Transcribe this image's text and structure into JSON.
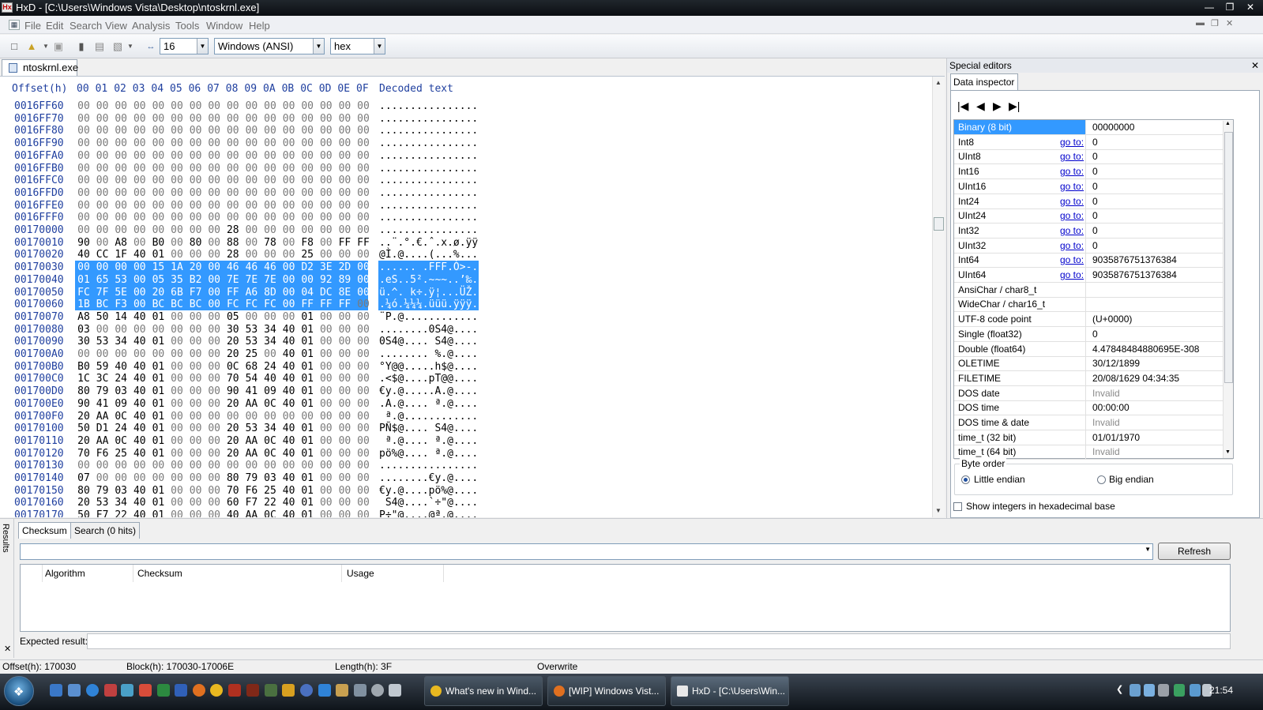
{
  "window": {
    "title": "HxD - [C:\\Users\\Windows Vista\\Desktop\\ntoskrnl.exe]"
  },
  "menu": [
    "File",
    "Edit",
    "Search",
    "View",
    "Analysis",
    "Tools",
    "Window",
    "Help"
  ],
  "toolbar": {
    "bytes_per_row": "16",
    "charset": "Windows (ANSI)",
    "offset_base": "hex"
  },
  "file_tab": "ntoskrnl.exe",
  "hex": {
    "offset_header": "Offset(h)",
    "columns": [
      "00",
      "01",
      "02",
      "03",
      "04",
      "05",
      "06",
      "07",
      "08",
      "09",
      "0A",
      "0B",
      "0C",
      "0D",
      "0E",
      "0F"
    ],
    "decoded_header": "Decoded text",
    "rows": [
      {
        "o": "0016FF60",
        "b": "00 00 00 00 00 00 00 00 00 00 00 00 00 00 00 00",
        "t": "................"
      },
      {
        "o": "0016FF70",
        "b": "00 00 00 00 00 00 00 00 00 00 00 00 00 00 00 00",
        "t": "................"
      },
      {
        "o": "0016FF80",
        "b": "00 00 00 00 00 00 00 00 00 00 00 00 00 00 00 00",
        "t": "................"
      },
      {
        "o": "0016FF90",
        "b": "00 00 00 00 00 00 00 00 00 00 00 00 00 00 00 00",
        "t": "................"
      },
      {
        "o": "0016FFA0",
        "b": "00 00 00 00 00 00 00 00 00 00 00 00 00 00 00 00",
        "t": "................"
      },
      {
        "o": "0016FFB0",
        "b": "00 00 00 00 00 00 00 00 00 00 00 00 00 00 00 00",
        "t": "................"
      },
      {
        "o": "0016FFC0",
        "b": "00 00 00 00 00 00 00 00 00 00 00 00 00 00 00 00",
        "t": "................"
      },
      {
        "o": "0016FFD0",
        "b": "00 00 00 00 00 00 00 00 00 00 00 00 00 00 00 00",
        "t": "................"
      },
      {
        "o": "0016FFE0",
        "b": "00 00 00 00 00 00 00 00 00 00 00 00 00 00 00 00",
        "t": "................"
      },
      {
        "o": "0016FFF0",
        "b": "00 00 00 00 00 00 00 00 00 00 00 00 00 00 00 00",
        "t": "................"
      },
      {
        "o": "00170000",
        "b": "00 00 00 00 00 00 00 00 28 00 00 00 00 00 00 00",
        "t": "................"
      },
      {
        "o": "00170010",
        "b": "90 00 A8 00 B0 00 80 00 88 00 78 00 F8 00 FF FF",
        "t": "..¨.°.€.ˆ.x.ø.ÿÿ"
      },
      {
        "o": "00170020",
        "b": "40 CC 1F 40 01 00 00 00 28 00 00 00 25 00 00 00",
        "t": "@Ì.@....(...%..."
      },
      {
        "o": "00170030",
        "b": "00 00 00 00 15 1A 20 00 46 46 46 00 D2 3E 2D 00",
        "t": "...... .FFF.Ò>-."
      },
      {
        "o": "00170040",
        "b": "01 65 53 00 05 35 B2 00 7E 7E 7E 00 00 92 89 00",
        "t": ".eS..5².~~~..’‰."
      },
      {
        "o": "00170050",
        "b": "FC 7F 5E 00 20 6B F7 00 FF A6 8D 00 04 DC 8E 00",
        "t": "ü.^. k÷.ÿ¦...ÜŽ."
      },
      {
        "o": "00170060",
        "b": "1B BC F3 00 BC BC BC 00 FC FC FC 00 FF FF FF 00",
        "t": ".¼ó.¼¼¼.üüü.ÿÿÿ."
      },
      {
        "o": "00170070",
        "b": "A8 50 14 40 01 00 00 00 05 00 00 00 01 00 00 00",
        "t": "¨P.@............"
      },
      {
        "o": "00170080",
        "b": "03 00 00 00 00 00 00 00 30 53 34 40 01 00 00 00",
        "t": "........0S4@...."
      },
      {
        "o": "00170090",
        "b": "30 53 34 40 01 00 00 00 20 53 34 40 01 00 00 00",
        "t": "0S4@.... S4@...."
      },
      {
        "o": "001700A0",
        "b": "00 00 00 00 00 00 00 00 20 25 00 40 01 00 00 00",
        "t": "........ %.@...."
      },
      {
        "o": "001700B0",
        "b": "B0 59 40 40 01 00 00 00 0C 68 24 40 01 00 00 00",
        "t": "°Y@@.....h$@...."
      },
      {
        "o": "001700C0",
        "b": "1C 3C 24 40 01 00 00 00 70 54 40 40 01 00 00 00",
        "t": ".<$@....pT@@...."
      },
      {
        "o": "001700D0",
        "b": "80 79 03 40 01 00 00 00 90 41 09 40 01 00 00 00",
        "t": "€y.@.....A.@...."
      },
      {
        "o": "001700E0",
        "b": "90 41 09 40 01 00 00 00 20 AA 0C 40 01 00 00 00",
        "t": ".A.@.... ª.@...."
      },
      {
        "o": "001700F0",
        "b": "20 AA 0C 40 01 00 00 00 00 00 00 00 00 00 00 00",
        "t": " ª.@............"
      },
      {
        "o": "00170100",
        "b": "50 D1 24 40 01 00 00 00 20 53 34 40 01 00 00 00",
        "t": "PÑ$@.... S4@...."
      },
      {
        "o": "00170110",
        "b": "20 AA 0C 40 01 00 00 00 20 AA 0C 40 01 00 00 00",
        "t": " ª.@.... ª.@...."
      },
      {
        "o": "00170120",
        "b": "70 F6 25 40 01 00 00 00 20 AA 0C 40 01 00 00 00",
        "t": "pö%@.... ª.@...."
      },
      {
        "o": "00170130",
        "b": "00 00 00 00 00 00 00 00 00 00 00 00 00 00 00 00",
        "t": "................"
      },
      {
        "o": "00170140",
        "b": "07 00 00 00 00 00 00 00 80 79 03 40 01 00 00 00",
        "t": "........€y.@...."
      },
      {
        "o": "00170150",
        "b": "80 79 03 40 01 00 00 00 70 F6 25 40 01 00 00 00",
        "t": "€y.@....pö%@...."
      },
      {
        "o": "00170160",
        "b": "20 53 34 40 01 00 00 00 60 F7 22 40 01 00 00 00",
        "t": " S4@....`÷\"@...."
      },
      {
        "o": "00170170",
        "b": "50 F7 22 40 01 00 00 00 40 AA 0C 40 01 00 00 00",
        "t": "P÷\"@....@ª.@...."
      }
    ]
  },
  "special_editors": {
    "title": "Special editors",
    "tab": "Data inspector",
    "rows": [
      {
        "name": "Binary (8 bit)",
        "goto": "",
        "value": "00000000"
      },
      {
        "name": "Int8",
        "goto": "go to:",
        "value": "0"
      },
      {
        "name": "UInt8",
        "goto": "go to:",
        "value": "0"
      },
      {
        "name": "Int16",
        "goto": "go to:",
        "value": "0"
      },
      {
        "name": "UInt16",
        "goto": "go to:",
        "value": "0"
      },
      {
        "name": "Int24",
        "goto": "go to:",
        "value": "0"
      },
      {
        "name": "UInt24",
        "goto": "go to:",
        "value": "0"
      },
      {
        "name": "Int32",
        "goto": "go to:",
        "value": "0"
      },
      {
        "name": "UInt32",
        "goto": "go to:",
        "value": "0"
      },
      {
        "name": "Int64",
        "goto": "go to:",
        "value": "9035876751376384"
      },
      {
        "name": "UInt64",
        "goto": "go to:",
        "value": "9035876751376384"
      },
      {
        "name": "AnsiChar / char8_t",
        "goto": "",
        "value": ""
      },
      {
        "name": "WideChar / char16_t",
        "goto": "",
        "value": ""
      },
      {
        "name": "UTF-8 code point",
        "goto": "",
        "value": "  (U+0000)"
      },
      {
        "name": "Single (float32)",
        "goto": "",
        "value": "0"
      },
      {
        "name": "Double (float64)",
        "goto": "",
        "value": "4.47848484880695E-308"
      },
      {
        "name": "OLETIME",
        "goto": "",
        "value": "30/12/1899"
      },
      {
        "name": "FILETIME",
        "goto": "",
        "value": "20/08/1629 04:34:35"
      },
      {
        "name": "DOS date",
        "goto": "",
        "value": "Invalid"
      },
      {
        "name": "DOS time",
        "goto": "",
        "value": "00:00:00"
      },
      {
        "name": "DOS time & date",
        "goto": "",
        "value": "Invalid"
      },
      {
        "name": "time_t (32 bit)",
        "goto": "",
        "value": "01/01/1970"
      },
      {
        "name": "time_t (64 bit)",
        "goto": "",
        "value": "Invalid"
      }
    ],
    "byte_order": {
      "label": "Byte order",
      "little": "Little endian",
      "big": "Big endian",
      "selected": "little"
    },
    "hex_ints": "Show integers in hexadecimal base"
  },
  "results": {
    "side_label": "Results",
    "tabs": [
      "Checksum",
      "Search (0 hits)"
    ],
    "refresh": "Refresh",
    "columns": [
      "Algorithm",
      "Checksum",
      "Usage"
    ],
    "expected_label": "Expected result:"
  },
  "status": {
    "offset": "Offset(h): 170030",
    "block": "Block(h): 170030-17006E",
    "length": "Length(h): 3F",
    "mode": "Overwrite"
  },
  "taskbar": {
    "tasks": [
      "What's new in Wind...",
      "[WIP] Windows Vist...",
      "HxD - [C:\\Users\\Win..."
    ],
    "clock": "21:54"
  }
}
